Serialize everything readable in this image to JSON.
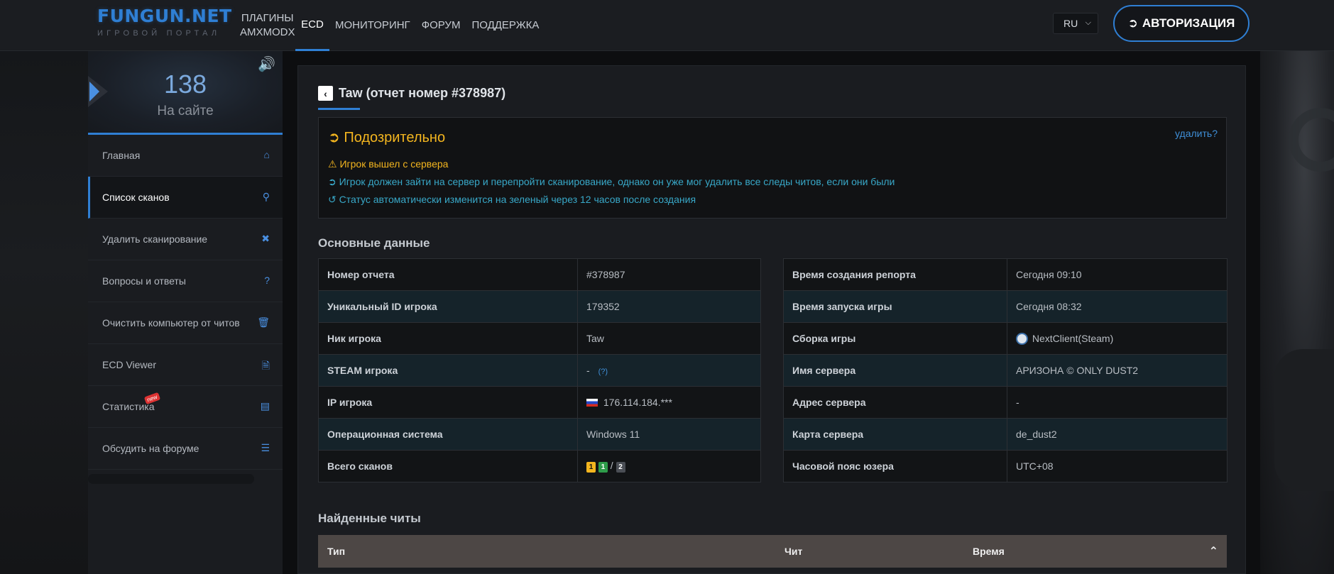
{
  "header": {
    "logo_title": "FUNGUN.NET",
    "logo_sub": "ИГРОВОЙ ПОРТАЛ",
    "nav": [
      {
        "label": "ПЛАГИНЫ AMXMODX"
      },
      {
        "label": "ECD"
      },
      {
        "label": "МОНИТОРИНГ"
      },
      {
        "label": "ФОРУМ"
      },
      {
        "label": "ПОДДЕРЖКА"
      }
    ],
    "lang": "RU",
    "auth_label": "АВТОРИЗАЦИЯ",
    "accent_color": "#2f7fd4"
  },
  "sidebar": {
    "online_count": "138",
    "online_label": "На сайте",
    "items": [
      {
        "label": "Главная",
        "icon": "home-icon"
      },
      {
        "label": "Список сканов",
        "icon": "search-icon"
      },
      {
        "label": "Удалить сканирование",
        "icon": "close-icon"
      },
      {
        "label": "Вопросы и ответы",
        "icon": "question-icon"
      },
      {
        "label": "Очистить компьютер от читов",
        "icon": "trash-icon"
      },
      {
        "label": "ECD Viewer",
        "icon": "file-icon"
      },
      {
        "label": "Статистика",
        "icon": "chart-icon",
        "badge": "new"
      },
      {
        "label": "Обсудить на форуме",
        "icon": "list-icon"
      }
    ]
  },
  "report": {
    "title": "Taw (отчет номер #378987)",
    "alert": {
      "title": "Подозрительно",
      "delete_link": "удалить?",
      "lines": [
        "Игрок вышел с сервера",
        "Игрок должен зайти на сервер и перепройти сканирование, однако он уже мог удалить все следы читов, если они были",
        "Статус автоматически изменится на зеленый через 12 часов после создания"
      ],
      "warning_color": "#f3b51f",
      "info_color": "#38a8c8"
    },
    "main_data_title": "Основные данные",
    "left_table": [
      {
        "key": "Номер отчета",
        "value": "#378987"
      },
      {
        "key": "Уникальный ID игрока",
        "value": "179352"
      },
      {
        "key": "Ник игрока",
        "value": "Taw"
      },
      {
        "key": "STEAM игрока",
        "value": "-",
        "extra": "(?)"
      },
      {
        "key": "IP игрока",
        "value": "176.114.184.***"
      },
      {
        "key": "Операционная система",
        "value": "Windows 11"
      },
      {
        "key": "Всего сканов",
        "badges": [
          "1",
          "1",
          "2"
        ],
        "sep": "/"
      }
    ],
    "right_table": [
      {
        "key": "Время создания репорта",
        "value": "Сегодня 09:10"
      },
      {
        "key": "Время запуска игры",
        "value": "Сегодня 08:32"
      },
      {
        "key": "Сборка игры",
        "value": "NextClient(Steam)"
      },
      {
        "key": "Имя сервера",
        "value": "АРИЗОНА © ONLY DUST2"
      },
      {
        "key": "Адрес сервера",
        "value": "-"
      },
      {
        "key": "Карта сервера",
        "value": "de_dust2"
      },
      {
        "key": "Часовой пояс юзера",
        "value": "UTC+08"
      }
    ],
    "cheats_title": "Найденные читы",
    "cheats_columns": [
      "Тип",
      "Чит",
      "Время"
    ]
  }
}
